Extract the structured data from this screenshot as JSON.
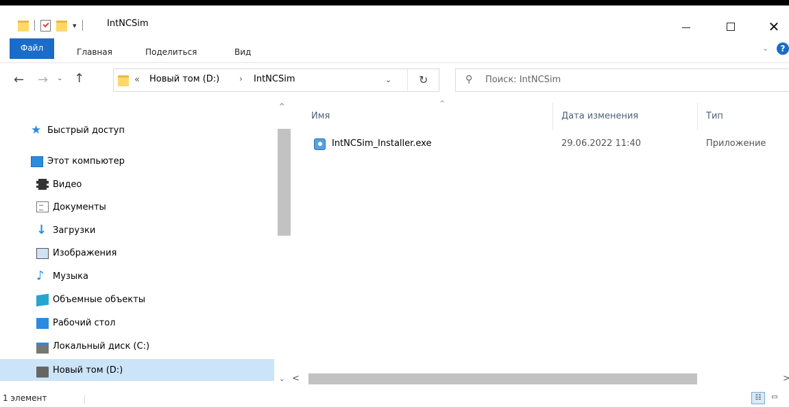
{
  "window": {
    "title": "IntNCSim",
    "controls": {
      "minimize_icon": "minimize-icon",
      "maximize_icon": "maximize-icon",
      "close": "✕"
    }
  },
  "quick_access_toolbar": {
    "dropdown_symbol": "▾"
  },
  "ribbon": {
    "tabs": [
      {
        "label": "Файл"
      },
      {
        "label": "Главная"
      },
      {
        "label": "Поделиться"
      },
      {
        "label": "Вид"
      }
    ],
    "expand_symbol": "⌄",
    "help_symbol": "?"
  },
  "navigation": {
    "back_symbol": "←",
    "forward_symbol": "→",
    "recent_symbol": "⌄",
    "up_symbol": "↑",
    "address": {
      "overflow_symbol": "«",
      "segments": [
        "Новый том (D:)",
        "IntNCSim"
      ],
      "separator": "›",
      "dropdown_symbol": "⌄",
      "refresh_symbol": "↻"
    },
    "search": {
      "placeholder": "Поиск: IntNCSim"
    }
  },
  "nav_pane": {
    "items": [
      {
        "label": "Быстрый доступ",
        "icon": "star-icon"
      },
      {
        "label": "Этот компьютер",
        "icon": "computer-icon"
      },
      {
        "label": "Видео",
        "icon": "film-icon"
      },
      {
        "label": "Документы",
        "icon": "document-icon"
      },
      {
        "label": "Загрузки",
        "icon": "download-icon"
      },
      {
        "label": "Изображения",
        "icon": "picture-icon"
      },
      {
        "label": "Музыка",
        "icon": "music-icon"
      },
      {
        "label": "Объемные объекты",
        "icon": "3d-objects-icon"
      },
      {
        "label": "Рабочий стол",
        "icon": "desktop-icon"
      },
      {
        "label": "Локальный диск (C:)",
        "icon": "drive-c-icon"
      },
      {
        "label": "Новый том (D:)",
        "icon": "drive-d-icon",
        "selected": true
      }
    ],
    "scroll_up_symbol": "^",
    "scroll_down_symbol": "⌄"
  },
  "file_list": {
    "columns": [
      "Имя",
      "Дата изменения",
      "Тип"
    ],
    "sort_symbol": "^",
    "rows": [
      {
        "name": "IntNCSim_Installer.exe",
        "modified": "29.06.2022 11:40",
        "type": "Приложение",
        "icon": "exe-icon"
      }
    ],
    "hscroll_left_symbol": "<",
    "hscroll_right_symbol": ">"
  },
  "status_bar": {
    "item_count": "1 элемент",
    "view_details_symbol": "☷",
    "view_tiles_symbol": "▭"
  },
  "colors": {
    "accent": "#1a6cc8",
    "selection": "#cce4f7",
    "header_text": "#4c607a"
  }
}
